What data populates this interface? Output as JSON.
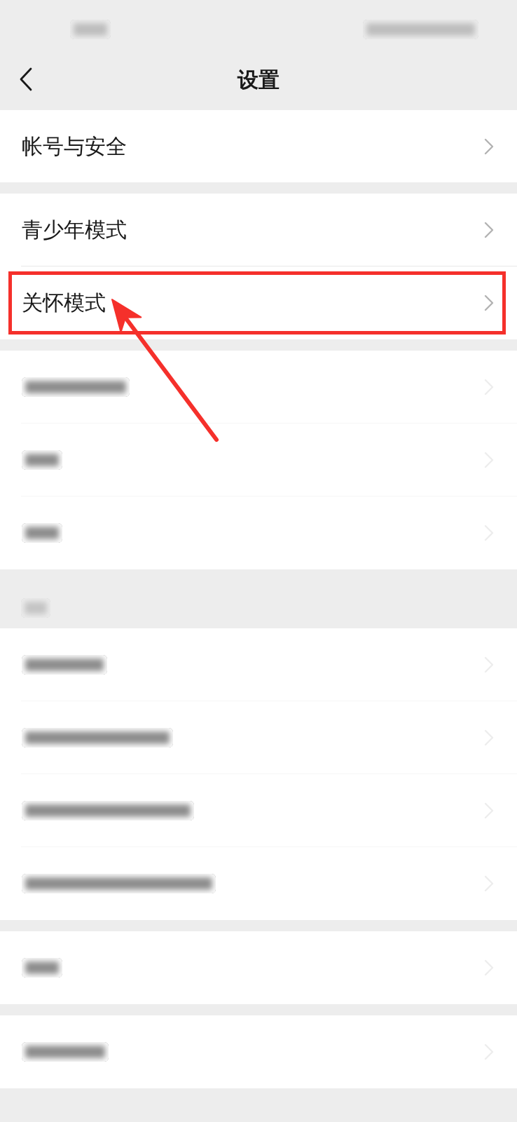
{
  "status_bar": {
    "items": [
      {
        "kind": "blurred"
      },
      {
        "kind": "blurred"
      }
    ]
  },
  "nav_bar": {
    "title": "设置"
  },
  "groups": [
    {
      "rows": [
        {
          "kind": "text",
          "label": "帐号与安全",
          "highlighted": false,
          "arrow": false
        }
      ]
    },
    {
      "rows": [
        {
          "kind": "text",
          "label": "青少年模式",
          "highlighted": false,
          "arrow": false
        },
        {
          "kind": "text",
          "label": "关怀模式",
          "highlighted": true,
          "arrow": true
        }
      ]
    },
    {
      "rows": [
        {
          "kind": "blurred",
          "highlighted": false,
          "arrow": false
        },
        {
          "kind": "blurred",
          "highlighted": false,
          "arrow": false
        },
        {
          "kind": "blurred",
          "highlighted": false,
          "arrow": false
        }
      ]
    },
    {
      "header": {
        "kind": "blurred"
      },
      "rows": [
        {
          "kind": "blurred",
          "highlighted": false,
          "arrow": false
        },
        {
          "kind": "blurred",
          "highlighted": false,
          "arrow": false
        },
        {
          "kind": "blurred",
          "highlighted": false,
          "arrow": false
        },
        {
          "kind": "blurred",
          "highlighted": false,
          "arrow": false
        }
      ]
    },
    {
      "rows": [
        {
          "kind": "blurred",
          "highlighted": false,
          "arrow": false
        }
      ]
    },
    {
      "rows": [
        {
          "kind": "blurred",
          "highlighted": false,
          "arrow": false
        }
      ]
    }
  ]
}
